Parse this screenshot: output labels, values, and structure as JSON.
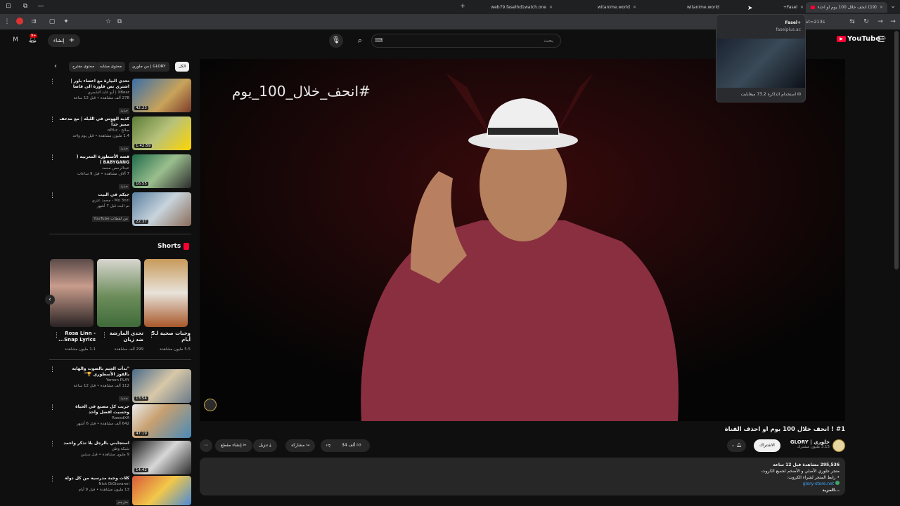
{
  "browser": {
    "tabs": [
      {
        "title": "web79.faselhd1watch.one"
      },
      {
        "title": "witanime.world"
      },
      {
        "title": "witanime.world"
      },
      {
        "title": "Fasel+"
      },
      {
        "title": "(19) انحف خلال 100 يوم او احذف..."
      }
    ],
    "tab_hover": {
      "title": "Fasel+",
      "url": "faselplus.ac",
      "memory": "استخدام الذاكرة 73.2 ميغابايت"
    },
    "url_tail": "Da8_T4l&t=213s"
  },
  "header": {
    "search_placeholder": "بحث",
    "search_value": "",
    "create_label": "إنشاء",
    "logo_text": "YouTube",
    "region": "SA",
    "notif_count": "9+"
  },
  "player": {
    "overlay_text": "#انحف_خلال_100_يوم",
    "title": "#1 ! انحف خلال 100 يوم او احذف القناة"
  },
  "channel": {
    "name": "جلوري | GLORY",
    "subs": "3.15 مليون مشترك",
    "subscribe_label": "الاشتراك"
  },
  "actions": {
    "likes": "34 ألف",
    "share": "مشاركة",
    "download": "تنزيل",
    "clip": "إنشاء مقطع"
  },
  "description": {
    "views_line": "295,536 مشاهدة قبل 12 ساعة",
    "line1": "متجر جلوري الأصلي و الأضخم لجميع الكروت",
    "line2": "• رابط المتجر لشراء الكروت:",
    "link": "glory-store.net",
    "more": "...المزيد"
  },
  "chips": [
    "الكل",
    "من جلوري | GLORY",
    "محتوى مشابه",
    "محتوى مقترح"
  ],
  "recommendations_top": [
    {
      "title": "تحدي البيارة مع اعضاء باور | اشتري تص فلورة الى فاضا",
      "channel": "XBear | أبو عابد الشمري",
      "meta": "278 ألف مشاهدة • قبل 12 ساعة",
      "duration": "42:23",
      "badge": "جديد"
    },
    {
      "title": "كذبة الهوس في الليلة | مع مدحف مميز جداً",
      "channel": "صالح - oPiLz",
      "meta": "1.4 مليون مشاهدة • قبل يوم واحد",
      "duration": "1:42:59",
      "badge": "جديد"
    },
    {
      "title": "قصة الأسطورة المغربية ( BABYGANG )",
      "channel": "عبدالرحمن محمد",
      "meta": "7 آلاف مشاهدة • قبل 9 ساعات",
      "duration": "16:55",
      "badge": "جديد"
    },
    {
      "title": "جيكم في البيت",
      "channel": "Mo 3nzi - محمد عنزي",
      "meta": "تم البث قبل 7 أشهر",
      "duration": "22:37",
      "badge": "من لقطات YouTube"
    }
  ],
  "shorts": {
    "heading": "Shorts",
    "items": [
      {
        "title": "وجبات صحية لـ5 أيام",
        "views": "5.5 مليون مشاهدة"
      },
      {
        "title": "تحدي المارشة ضد زيان",
        "views": "299 ألف مشاهدة"
      },
      {
        "title": "Rosa Linn - Snap Lyrics...",
        "views": "1.1 مليون مشاهدة"
      }
    ]
  },
  "recommendations_bottom": [
    {
      "title": "\"بدأت الجيم بالصوت والهاية بالفوز الأسطوري 🏆\"",
      "channel": "Yamen PLAY",
      "meta": "112 ألف مشاهدة • قبل 12 ساعة",
      "duration": "13:54",
      "badge": "جديد"
    },
    {
      "title": "جربت كل مصنع في الحياة وحسيت افضل واحد",
      "channel": "RaeedXA",
      "meta": "642 ألف مشاهدة • قبل 6 أشهر",
      "duration": "47:19",
      "badge": ""
    },
    {
      "title": "استجابني بالرجل بلا تذكر واحمد",
      "channel": "شبكة وطن",
      "meta": "9 مليون مشاهدة • قبل سنتين",
      "duration": "14:42",
      "badge": ""
    },
    {
      "title": "كلات وجبة مدرسية من كل دولة",
      "channel": "Nick DiGiovanni",
      "meta": "13 مليون مشاهدة • قبل 9 أيام",
      "duration": "",
      "badge": "مترجم"
    }
  ]
}
